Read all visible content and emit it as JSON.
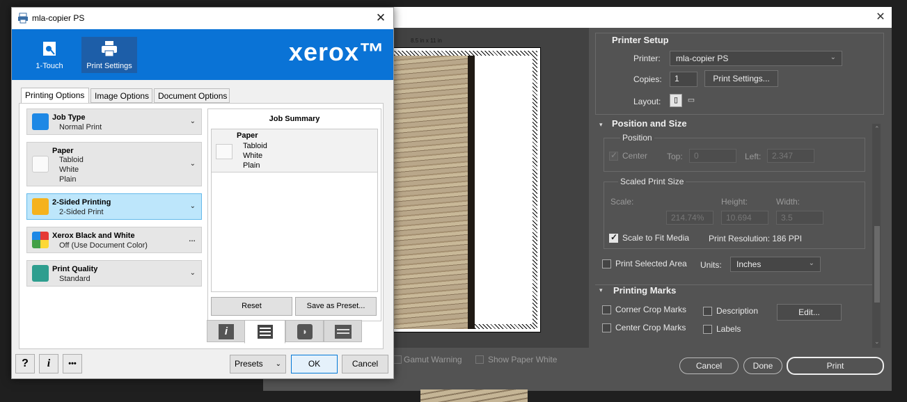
{
  "photoshop": {
    "page_size_label": "8.5 in x 11 in",
    "gamut_warning": "Gamut Warning",
    "show_paper_white": "Show Paper White",
    "printer_setup": {
      "heading": "Printer Setup",
      "printer_label": "Printer:",
      "printer_value": "mla-copier PS",
      "copies_label": "Copies:",
      "copies_value": "1",
      "print_settings_button": "Print Settings...",
      "layout_label": "Layout:"
    },
    "position_and_size": {
      "heading": "Position and Size",
      "position_heading": "Position",
      "center_label": "Center",
      "top_label": "Top:",
      "top_value": "0",
      "left_label": "Left:",
      "left_value": "2.347",
      "scaled_heading": "Scaled Print Size",
      "scale_label": "Scale:",
      "height_label": "Height:",
      "width_label": "Width:",
      "scale_value": "214.74%",
      "height_value": "10.694",
      "width_value": "3.5",
      "scale_to_fit": "Scale to Fit Media",
      "print_resolution": "Print Resolution: 186 PPI",
      "print_selected_area": "Print Selected Area",
      "units_label": "Units:",
      "units_value": "Inches"
    },
    "printing_marks": {
      "heading": "Printing Marks",
      "corner_crop": "Corner Crop Marks",
      "center_crop": "Center Crop Marks",
      "description": "Description",
      "labels": "Labels",
      "edit_button": "Edit..."
    },
    "buttons": {
      "cancel": "Cancel",
      "done": "Done",
      "print": "Print"
    }
  },
  "xerox": {
    "title": "mla-copier PS",
    "nav": [
      {
        "label": "1-Touch"
      },
      {
        "label": "Print Settings"
      }
    ],
    "logo": "xerox™",
    "tabs": [
      "Printing Options",
      "Image Options",
      "Document Options"
    ],
    "options": [
      {
        "title": "Job Type",
        "values": [
          "Normal Print"
        ]
      },
      {
        "title": "Paper",
        "values": [
          "Tabloid",
          "White",
          "Plain"
        ]
      },
      {
        "title": "2-Sided Printing",
        "values": [
          "2-Sided Print"
        ]
      },
      {
        "title": "Xerox Black and White",
        "values": [
          "Off (Use Document Color)"
        ]
      },
      {
        "title": "Print Quality",
        "values": [
          "Standard"
        ]
      }
    ],
    "summary": {
      "title": "Job Summary",
      "item_title": "Paper",
      "item_values": [
        "Tabloid",
        "White",
        "Plain"
      ],
      "reset": "Reset",
      "save_preset": "Save as Preset..."
    },
    "footer": {
      "help": "?",
      "info": "i",
      "more": "•••",
      "presets": "Presets",
      "ok": "OK",
      "cancel": "Cancel"
    },
    "colors": {
      "banner": "#0a73d6",
      "selected_option": "#bde6fb"
    }
  }
}
